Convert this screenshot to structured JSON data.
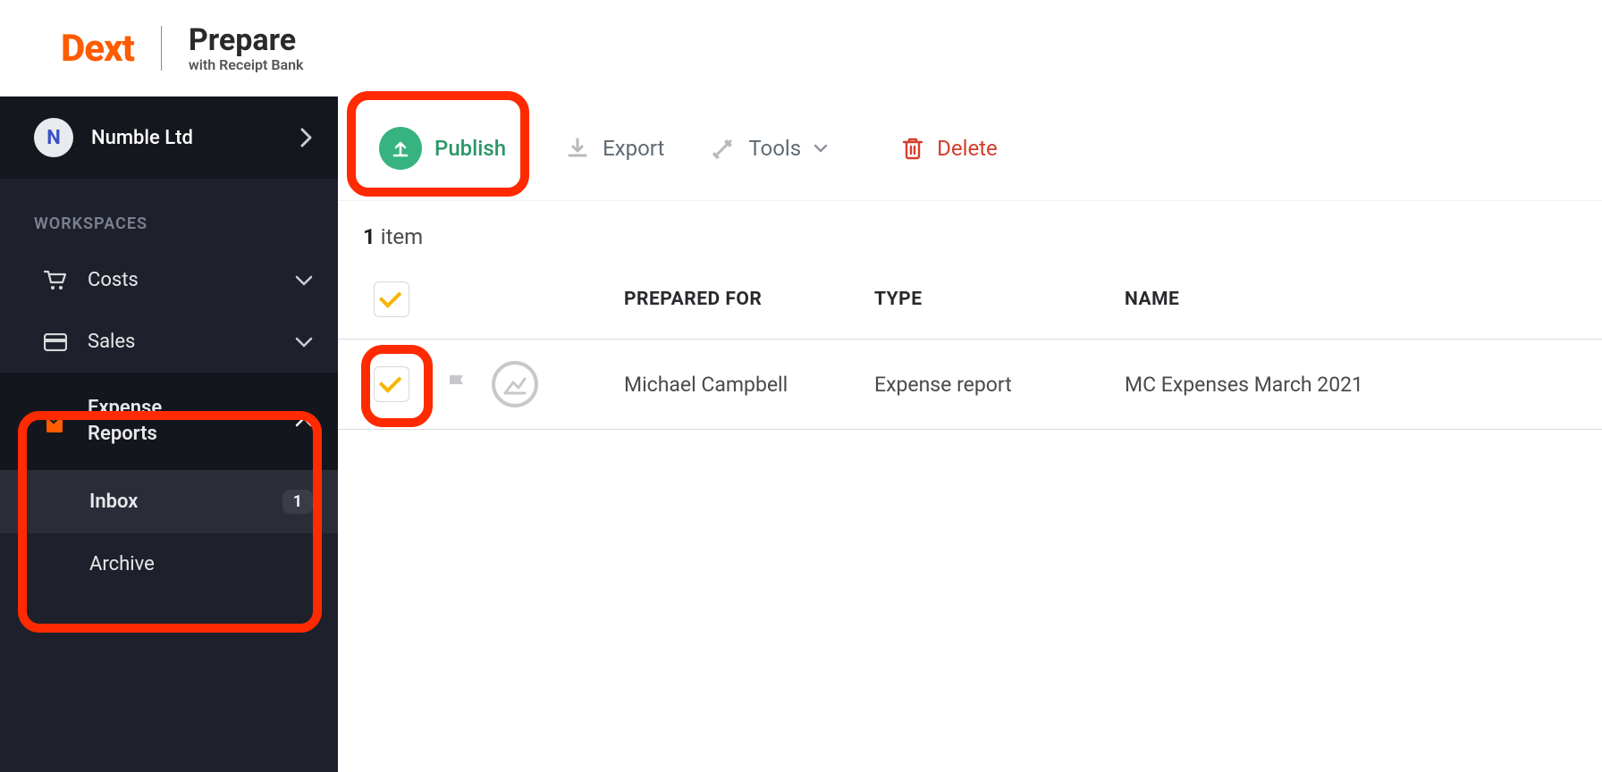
{
  "header": {
    "brand": "Dext",
    "product": "Prepare",
    "subtitle": "with Receipt Bank"
  },
  "sidebar": {
    "company": {
      "initial": "N",
      "name": "Numble Ltd"
    },
    "section_label": "WORKSPACES",
    "items": {
      "costs": "Costs",
      "sales": "Sales",
      "expense_line1": "Expense",
      "expense_line2": "Reports",
      "inbox": "Inbox",
      "inbox_count": "1",
      "archive": "Archive"
    }
  },
  "toolbar": {
    "publish": "Publish",
    "export": "Export",
    "tools": "Tools",
    "delete": "Delete"
  },
  "list": {
    "count_num": "1",
    "count_word": " item",
    "headers": {
      "prepared_for": "PREPARED FOR",
      "type": "TYPE",
      "name": "NAME"
    },
    "row": {
      "prepared_for": "Michael Campbell",
      "type": "Expense report",
      "name": "MC Expenses March 2021"
    }
  },
  "icons": {
    "publish": "publish-icon",
    "export": "export-icon",
    "tools": "tools-icon",
    "delete": "delete-icon",
    "flag": "flag-icon",
    "building": "building-icon",
    "cart": "cart-icon",
    "card": "card-icon",
    "report": "report-icon"
  },
  "colors": {
    "brand_orange": "#FF5B00",
    "publish_green": "#36b380",
    "danger_red": "#d43d2b",
    "highlight_red": "#ff2a00"
  }
}
